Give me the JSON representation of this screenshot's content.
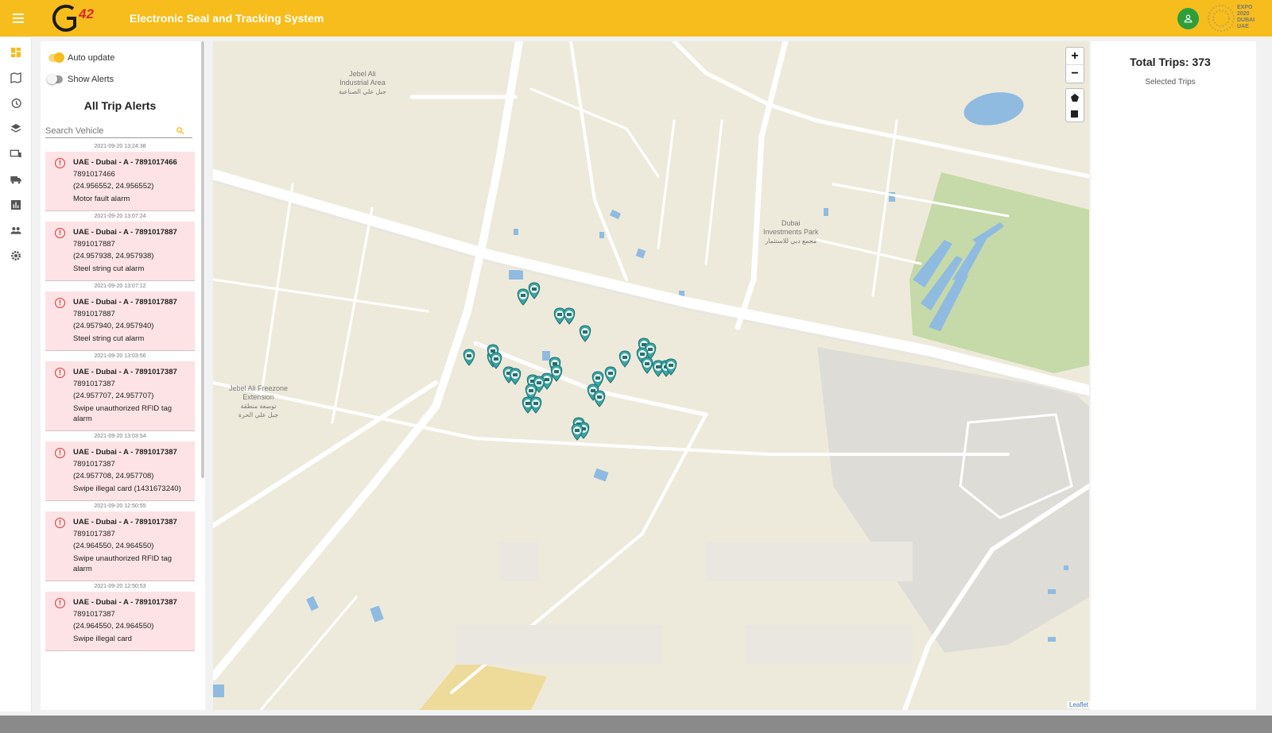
{
  "header": {
    "app_title": "Electronic Seal and Tracking System",
    "logo_text": "G42",
    "expo_text": "EXPO\n2020\nDUBAI\nUAE"
  },
  "navrail": {
    "items": [
      {
        "icon": "dashboard-icon",
        "active": true
      },
      {
        "icon": "map-icon",
        "active": false
      },
      {
        "icon": "history-icon",
        "active": false
      },
      {
        "icon": "layers-icon",
        "active": false
      },
      {
        "icon": "devices-icon",
        "active": false
      },
      {
        "icon": "truck-icon",
        "active": false
      },
      {
        "icon": "report-icon",
        "active": false
      },
      {
        "icon": "users-icon",
        "active": false
      },
      {
        "icon": "settings-icon",
        "active": false
      }
    ]
  },
  "alerts_panel": {
    "auto_update_label": "Auto update",
    "auto_update_on": true,
    "show_alerts_label": "Show Alerts",
    "show_alerts_on": false,
    "title": "All Trip Alerts",
    "search_placeholder": "Search Vehicle",
    "alerts": [
      {
        "time": "2021-09-20 13:24:38",
        "vehicle": "UAE - Dubai - A - 7891017466",
        "id": "7891017466",
        "coords": "(24.956552, 24.956552)",
        "type": "Motor fault alarm"
      },
      {
        "time": "2021-09-20 13:07:24",
        "vehicle": "UAE - Dubai - A - 7891017887",
        "id": "7891017887",
        "coords": "(24.957938, 24.957938)",
        "type": "Steel string cut alarm"
      },
      {
        "time": "2021-09-20 13:07:12",
        "vehicle": "UAE - Dubai - A - 7891017887",
        "id": "7891017887",
        "coords": "(24.957940, 24.957940)",
        "type": "Steel string cut alarm"
      },
      {
        "time": "2021-09-20 13:03:56",
        "vehicle": "UAE - Dubai - A - 7891017387",
        "id": "7891017387",
        "coords": "(24.957707, 24.957707)",
        "type": "Swipe unauthorized RFID tag alarm"
      },
      {
        "time": "2021-09-20 13:03:54",
        "vehicle": "UAE - Dubai - A - 7891017387",
        "id": "7891017387",
        "coords": "(24.957708, 24.957708)",
        "type": "Swipe illegal card (1431673240)"
      },
      {
        "time": "2021-09-20 12:50:55",
        "vehicle": "UAE - Dubai - A - 7891017387",
        "id": "7891017387",
        "coords": "(24.964550, 24.964550)",
        "type": "Swipe unauthorized RFID tag alarm"
      },
      {
        "time": "2021-09-20 12:50:53",
        "vehicle": "UAE - Dubai - A - 7891017387",
        "id": "7891017387",
        "coords": "(24.964550, 24.964550)",
        "type": "Swipe illegal card"
      }
    ]
  },
  "map": {
    "zoom_in": "+",
    "zoom_out": "−",
    "attribution": "Leaflet",
    "labels": {
      "jebel_ali_industrial": "Jebel Ali\nIndustrial Area",
      "jebel_ali_industrial_ar": "جبل علي الصناعية",
      "dubai_investments": "Dubai\nInvestments Park",
      "dubai_investments_ar": "مجمع دبي للاستثمار",
      "freezone_ext": "Jebel Ali Freezone\nExtension",
      "freezone_ext_ar": "توسعة منطقة\nجبل علي الحرة"
    }
  },
  "right_panel": {
    "total_trips": "Total Trips: 373",
    "selected_trips": "Selected Trips"
  },
  "colors": {
    "header": "#f7bd1c",
    "alert_bg": "#fde3e5",
    "marker": "#3aa6a4",
    "map_bg": "#eeeadb",
    "water": "#8fbbe0",
    "park": "#c6d9a8"
  }
}
